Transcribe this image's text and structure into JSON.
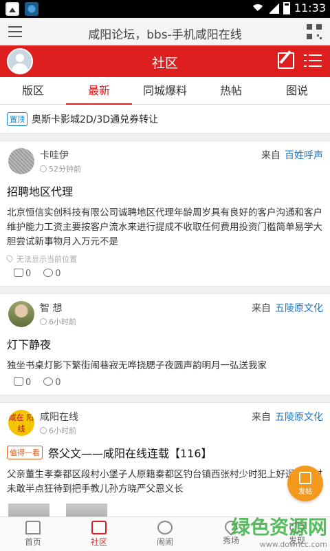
{
  "status_bar": {
    "time": "11:33"
  },
  "browser": {
    "title": "咸阳论坛，bbs-手机咸阳在线"
  },
  "header": {
    "title": "社区"
  },
  "tabs": [
    {
      "label": "版区"
    },
    {
      "label": "最新",
      "active": true
    },
    {
      "label": "同城爆料"
    },
    {
      "label": "热帖"
    },
    {
      "label": "图说"
    }
  ],
  "pinned": {
    "badge": "置顶",
    "title": "奥斯卡影城2D/3D通兑券转让"
  },
  "posts": [
    {
      "author": "卡哇伊",
      "time": "52分钟前",
      "from_label": "来自",
      "board": "百姓呼声",
      "title": "招聘地区代理",
      "body": "北京恒信实创科技有限公司诚聘地区代理年龄周岁具有良好的客户沟通和客户维护能力工资主要按客户流水来进行提成不收取任何费用投资门槛简单易学大胆尝试新事物月入万元不是",
      "location": "无法显示当前位置",
      "likes": "0",
      "comments": "0"
    },
    {
      "author": "智 想",
      "time": "6小时前",
      "from_label": "来自",
      "board": "五陵原文化",
      "title": "灯下静夜",
      "body": "独坐书桌灯影下繁街闹巷寂无哗挠腮子夜圆声韵明月一弘送我家",
      "likes": "0",
      "comments": "0"
    },
    {
      "author": "咸阳在线",
      "avatar_text": "咸在 阳线",
      "time": "6小时前",
      "from_label": "来自",
      "board": "五陵原文化",
      "badge": "值得一看",
      "title": "祭父文——咸阳在线连载【116】",
      "body": "父亲董生孝秦都区段村小堡子人原籍秦都区钓台镇西张村少时犯上好逞强省时未敢半点狂待到把手教儿孙方晓严父恩义长"
    }
  ],
  "fab": {
    "label": "发帖"
  },
  "bottom_nav": [
    {
      "label": "首页",
      "icon": "home-icon"
    },
    {
      "label": "社区",
      "icon": "community-icon",
      "active": true
    },
    {
      "label": "闹闹",
      "icon": "chat-icon"
    },
    {
      "label": "秀场",
      "icon": "star-icon"
    },
    {
      "label": "发现",
      "icon": "eye-icon"
    }
  ],
  "watermark": {
    "main": "绿色资源网",
    "sub": "www.downcc.com"
  },
  "colors": {
    "brand_red": "#dd1f1f",
    "link_blue": "#1a75c9",
    "fab_orange": "#f39a1e"
  }
}
